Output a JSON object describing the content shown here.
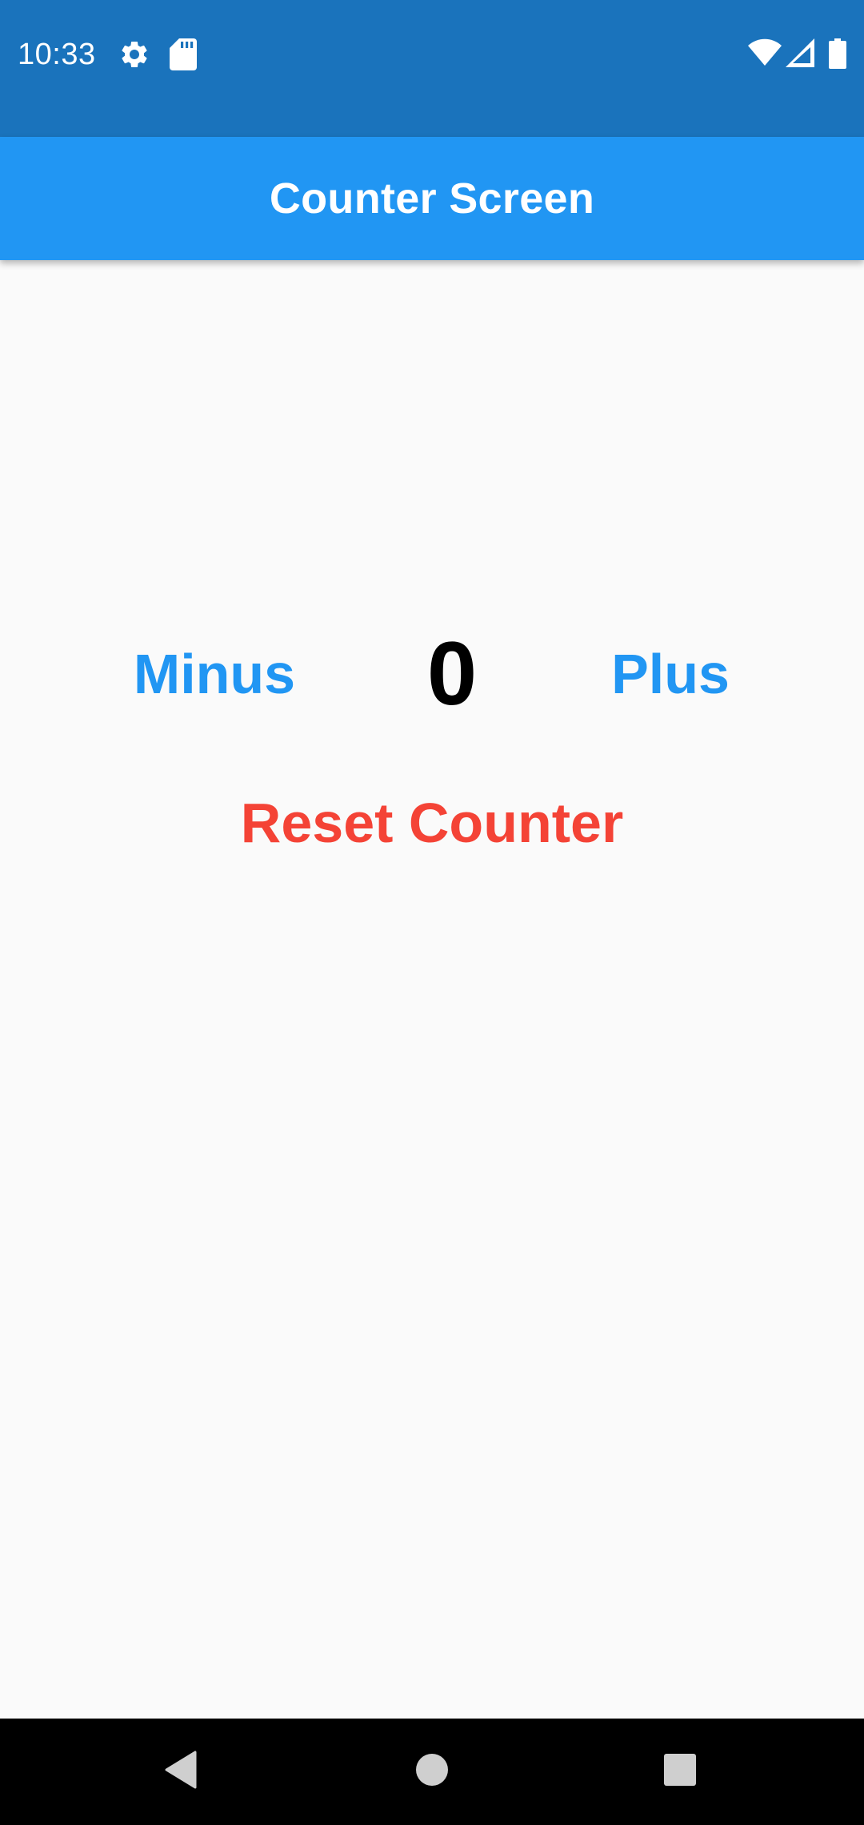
{
  "status_bar": {
    "time": "10:33",
    "background": "#1a73bc",
    "icons": [
      "gear-icon",
      "sd-card-icon",
      "wifi-icon",
      "signal-icon",
      "battery-icon"
    ]
  },
  "app_bar": {
    "title": "Counter Screen",
    "background": "#2196f3"
  },
  "counter": {
    "minus_label": "Minus",
    "value": "0",
    "plus_label": "Plus",
    "reset_label": "Reset Counter"
  },
  "colors": {
    "accent": "#2196f3",
    "reset": "#f44336",
    "background": "#fafafa"
  },
  "nav_bar": {
    "icons": [
      "back-icon",
      "home-icon",
      "recents-icon"
    ]
  }
}
